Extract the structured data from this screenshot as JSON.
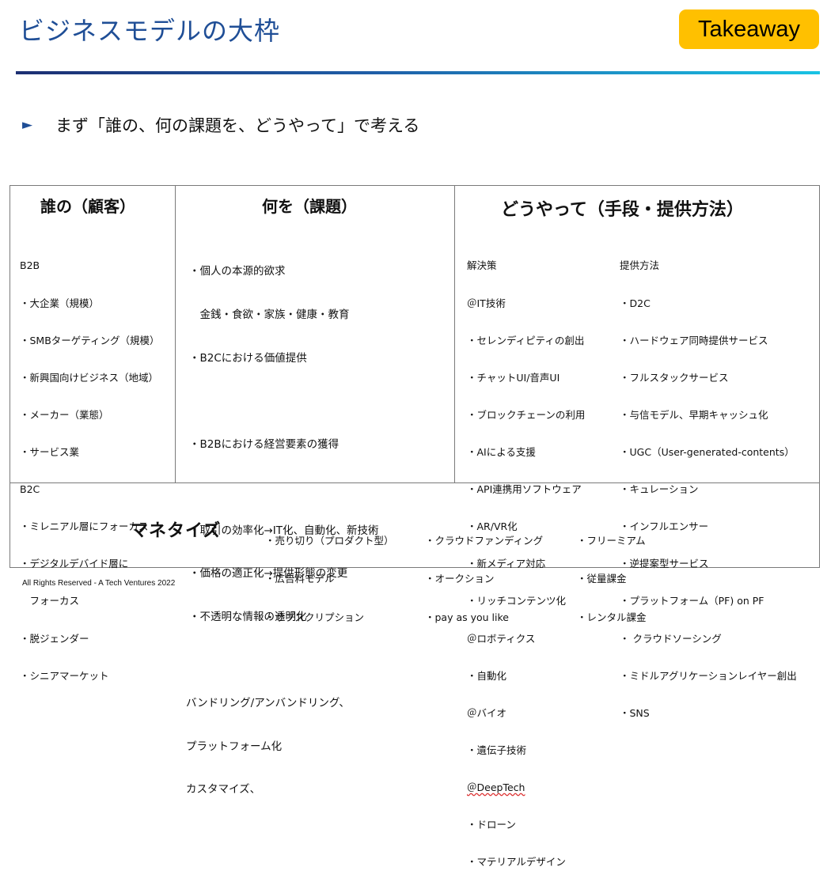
{
  "title": "ビジネスモデルの大枠",
  "badge": "Takeaway",
  "lead_arrow": "►",
  "lead_text": "まず「誰の、何の課題を、どうやって」で考える",
  "who": {
    "header": "誰の（顧客）",
    "lines": [
      "B2B",
      "・大企業（規模）",
      "・SMBターゲティング（規模）",
      "・新興国向けビジネス（地域）",
      "・メーカー（業態）",
      "・サービス業",
      "B2C",
      "・ミレニアル層にフォーカス",
      "・デジタルデバイド層に",
      "　フォーカス",
      "・脱ジェンダー",
      "・シニアマーケット"
    ]
  },
  "what": {
    "header": "何を（課題）",
    "group1": [
      "・個人の本源的欲求",
      "　金銭・食欲・家族・健康・教育",
      "・B2Cにおける価値提供"
    ],
    "group2": [
      "・B2Bにおける経営要素の獲得"
    ],
    "group3": [
      "・取引の効率化→IT化、自動化、新技術",
      "・価格の適正化→提供形態の変更",
      "・不透明な情報の透明化"
    ],
    "group4": [
      "バンドリング/アンバンドリング、",
      "プラットフォーム化",
      "カスタマイズ、"
    ]
  },
  "how": {
    "header": "どうやって（手段・提供方法）",
    "solutions": [
      "解決策",
      "＠IT技術",
      "・セレンディピティの創出",
      "・チャットUI/音声UI",
      "・ブロックチェーンの利用",
      "・AIによる支援",
      "・API連携用ソフトウェア",
      "・AR/VR化",
      "・新メディア対応",
      "・リッチコンテンツ化",
      "＠ロボティクス",
      "・自動化",
      "＠バイオ",
      "・遺伝子技術"
    ],
    "deeptech": "＠DeepTech",
    "solutions_tail": [
      "・ドローン",
      "・マテリアルデザイン"
    ],
    "methods": [
      "提供方法",
      "・D2C",
      "・ハードウェア同時提供サービス",
      "・フルスタックサービス",
      "・与信モデル、早期キャッシュ化",
      "・UGC（User-generated-contents）",
      "・キュレーション",
      "・インフルエンサー",
      "・逆提案型サービス",
      "・プラットフォーム（PF) on PF",
      "・ クラウドソーシング",
      "・ミドルアグリケーションレイヤー創出",
      "・SNS"
    ]
  },
  "monetize": {
    "header": "マネタイズ",
    "col1": [
      "・売り切り（プロダクト型）",
      "・広告料モデル",
      "・サブスクリプション"
    ],
    "col2": [
      "・クラウドファンディング",
      "・オークション",
      "・pay as you like"
    ],
    "col3": [
      "・フリーミアム",
      "・従量課金",
      "・レンタル課金"
    ]
  },
  "footer": "All Rights Reserved - A Tech Ventures 2022"
}
